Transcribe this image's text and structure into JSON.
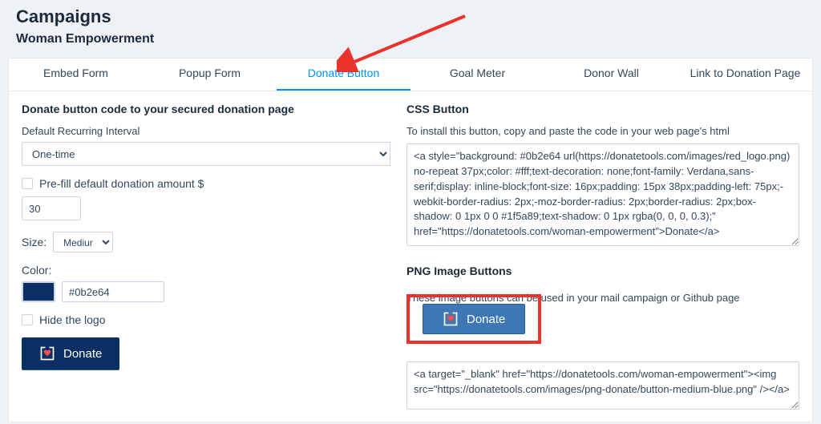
{
  "page": {
    "title": "Campaigns",
    "subtitle": "Woman Empowerment"
  },
  "tabs": [
    "Embed Form",
    "Popup Form",
    "Donate Button",
    "Goal Meter",
    "Donor Wall",
    "Link to Donation Page"
  ],
  "active_tab_index": 2,
  "left": {
    "section_title": "Donate button code to your secured donation page",
    "recurring_label": "Default Recurring Interval",
    "recurring_value": "One-time",
    "prefill_label": "Pre-fill default donation amount $",
    "prefill_amount": "30",
    "size_label": "Size:",
    "size_value": "Medium",
    "color_label": "Color:",
    "color_value": "#0b2e64",
    "hide_logo_label": "Hide the logo",
    "donate_label": "Donate"
  },
  "right": {
    "css_title": "CSS Button",
    "css_help": "To install this button, copy and paste the code in your web page's html",
    "css_code": "<a style=\"background: #0b2e64 url(https://donatetools.com/images/red_logo.png) no-repeat 37px;color: #fff;text-decoration: none;font-family: Verdana,sans-serif;display: inline-block;font-size: 16px;padding: 15px 38px;padding-left: 75px;-webkit-border-radius: 2px;-moz-border-radius: 2px;border-radius: 2px;box-shadow: 0 1px 0 0 #1f5a89;text-shadow: 0 1px rgba(0, 0, 0, 0.3);\" href=\"https://donatetools.com/woman-empowerment\">Donate</a>",
    "png_title": "PNG Image Buttons",
    "png_help": "These image buttons can be used in your mail campaign or Github page",
    "png_donate_label": "Donate",
    "png_code": "<a target=\"_blank\" href=\"https://donatetools.com/woman-empowerment\"><img src=\"https://donatetools.com/images/png-donate/button-medium-blue.png\" /></a>"
  }
}
